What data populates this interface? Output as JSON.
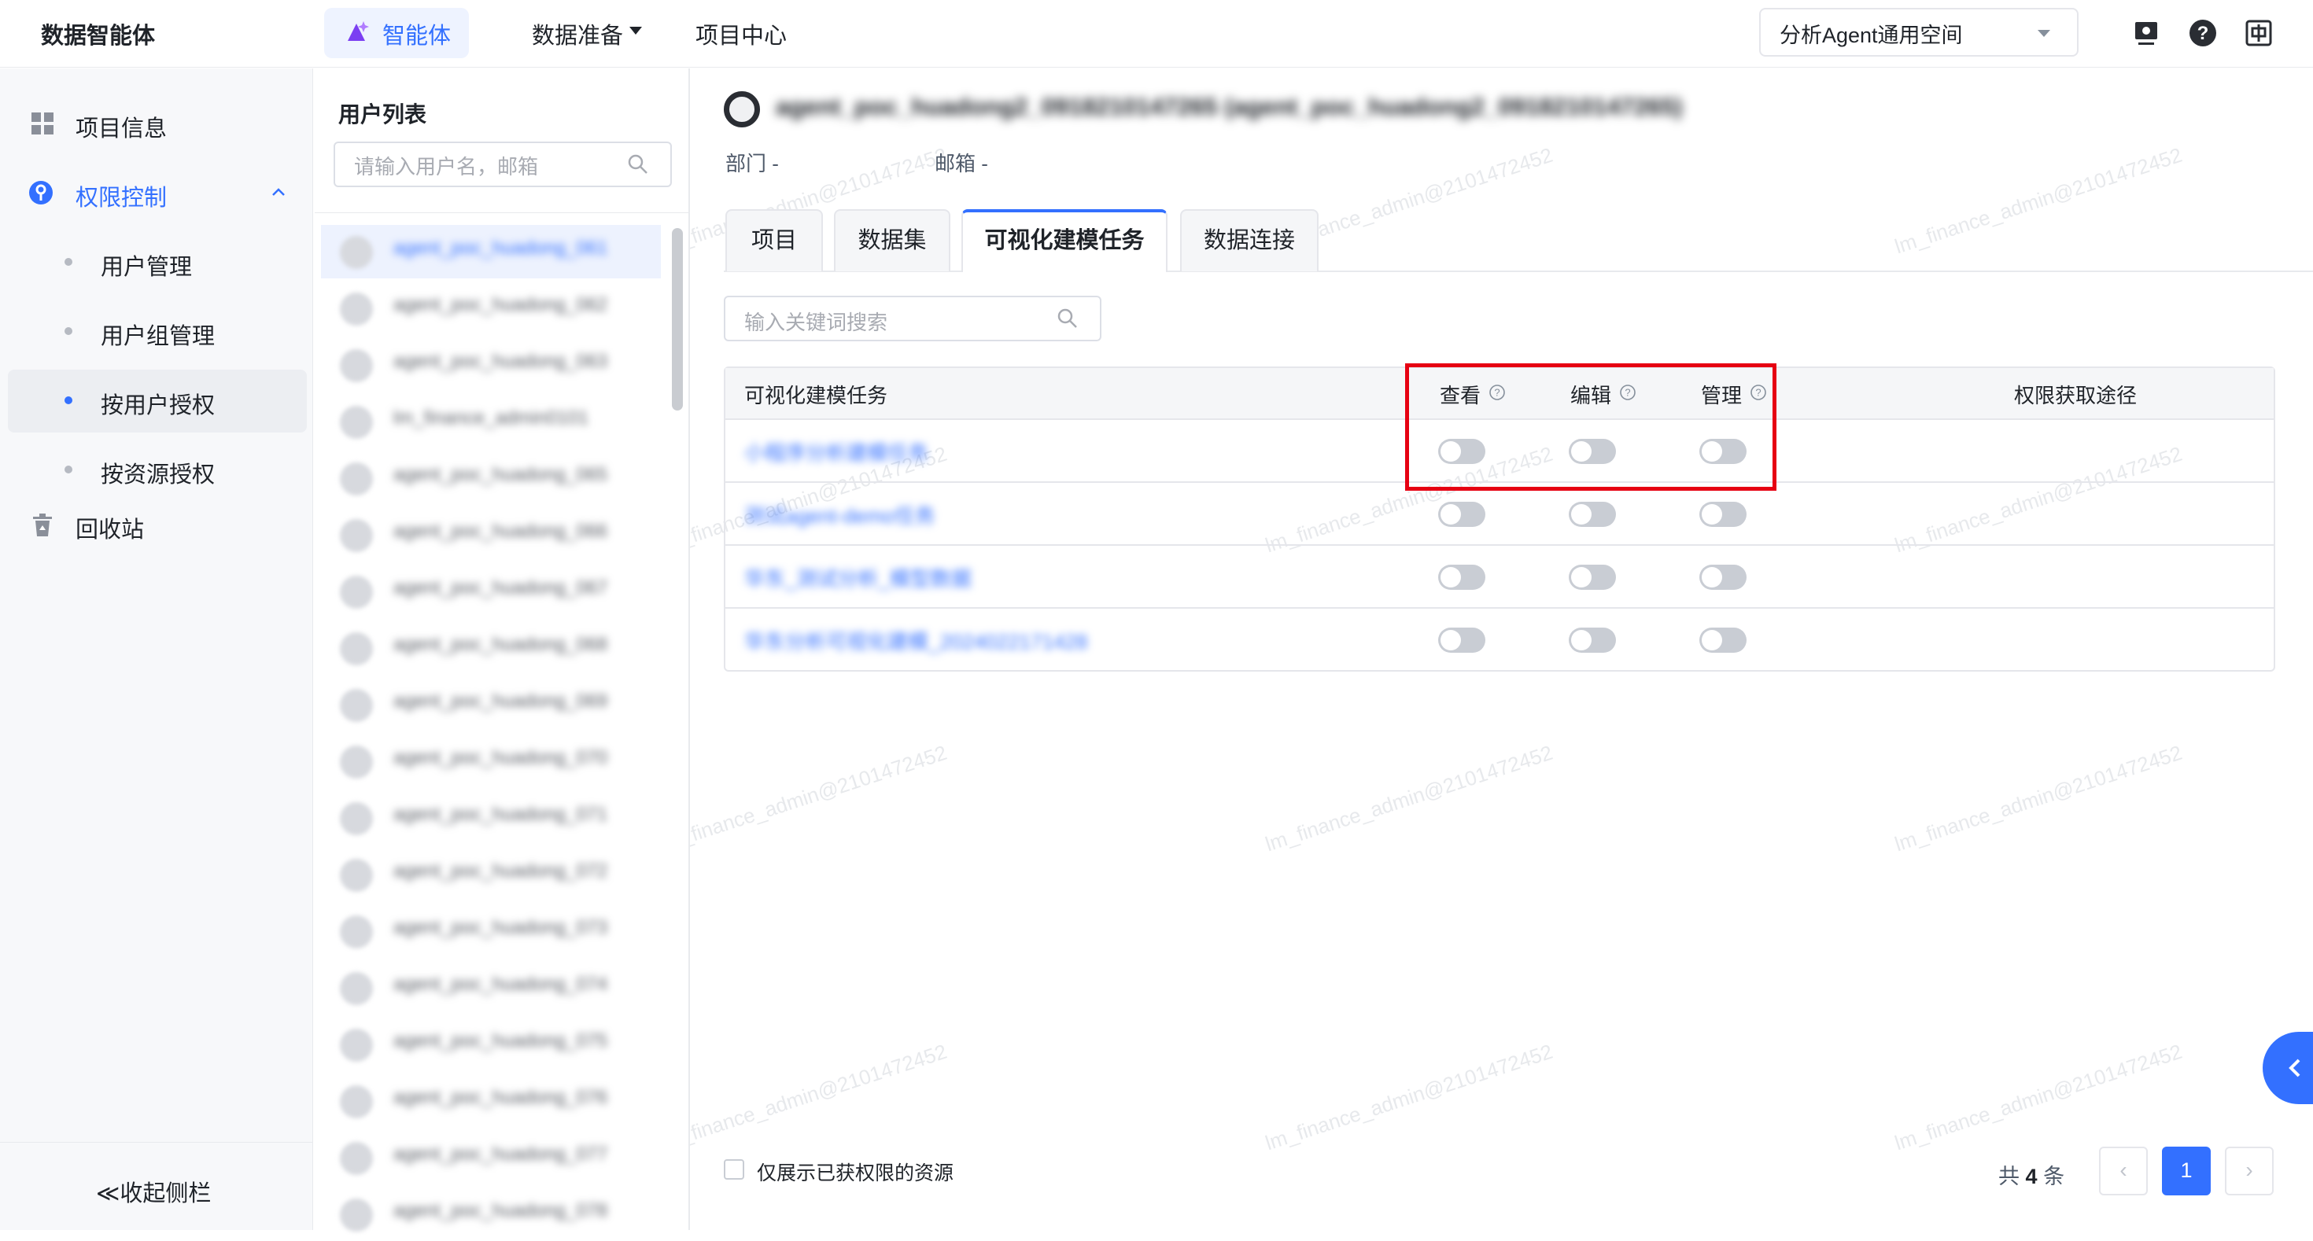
{
  "app": {
    "brand": "数据智能体",
    "nav": {
      "agent": "智能体",
      "data_prep": "数据准备",
      "project_center": "项目中心"
    },
    "space": "分析Agent通用空间",
    "watermark": "lm_finance_admin@2101472452"
  },
  "sidebar": {
    "project_info": "项目信息",
    "permission": "权限控制",
    "user_mgmt": "用户管理",
    "group_mgmt": "用户组管理",
    "by_user": "按用户授权",
    "by_resource": "按资源授权",
    "recycle": "回收站",
    "collapse": "≪收起侧栏"
  },
  "user_list": {
    "title": "用户列表",
    "search_placeholder": "请输入用户名，邮箱",
    "users": [
      "agent_poc_huadong_061",
      "agent_poc_huadong_062",
      "agent_poc_huadong_063",
      "lm_finance_admin0101",
      "agent_poc_huadong_065",
      "agent_poc_huadong_066",
      "agent_poc_huadong_067",
      "agent_poc_huadong_068",
      "agent_poc_huadong_069",
      "agent_poc_huadong_070",
      "agent_poc_huadong_071",
      "agent_poc_huadong_072",
      "agent_poc_huadong_073",
      "agent_poc_huadong_074",
      "agent_poc_huadong_075",
      "agent_poc_huadong_076",
      "agent_poc_huadong_077",
      "agent_poc_huadong_078"
    ]
  },
  "main": {
    "username": "agent_poc_huadong2_0918210147265 (agent_poc_huadong2_0918210147265)",
    "dept": "部门  -",
    "email": "邮箱  -",
    "tabs": [
      "项目",
      "数据集",
      "可视化建模任务",
      "数据连接"
    ],
    "search_placeholder": "输入关键词搜索",
    "table": {
      "headers": {
        "task": "可视化建模任务",
        "view": "查看",
        "edit": "编辑",
        "manage": "管理",
        "path": "权限获取途径"
      },
      "rows": [
        {
          "task": "小程序分析建模任务"
        },
        {
          "task": "测试agent-demo任务"
        },
        {
          "task": "华东_测试分析_模型数据"
        },
        {
          "task": "华东分析可视化建模_2024022171428"
        }
      ]
    },
    "only_granted": "仅展示已获权限的资源",
    "total_prefix": "共",
    "total": "4",
    "total_suffix": "条",
    "page": "1"
  }
}
